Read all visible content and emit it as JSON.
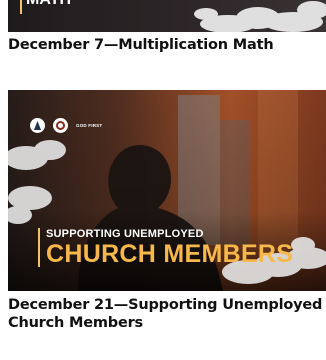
{
  "cards": [
    {
      "peek_text": "MATH",
      "title": "December 7—Multiplication Math"
    },
    {
      "logo_text": "GOD FIRST",
      "headline_line1": "SUPPORTING UNEMPLOYED",
      "headline_line2": "CHURCH MEMBERS",
      "title": "December 21—Supporting Unemployed Church Members"
    }
  ],
  "colors": {
    "title_text": "#111111",
    "accent_gold": "#f6b84b",
    "thumb_dark": "#2b2321",
    "thumb_orange": "#c05a2c"
  }
}
